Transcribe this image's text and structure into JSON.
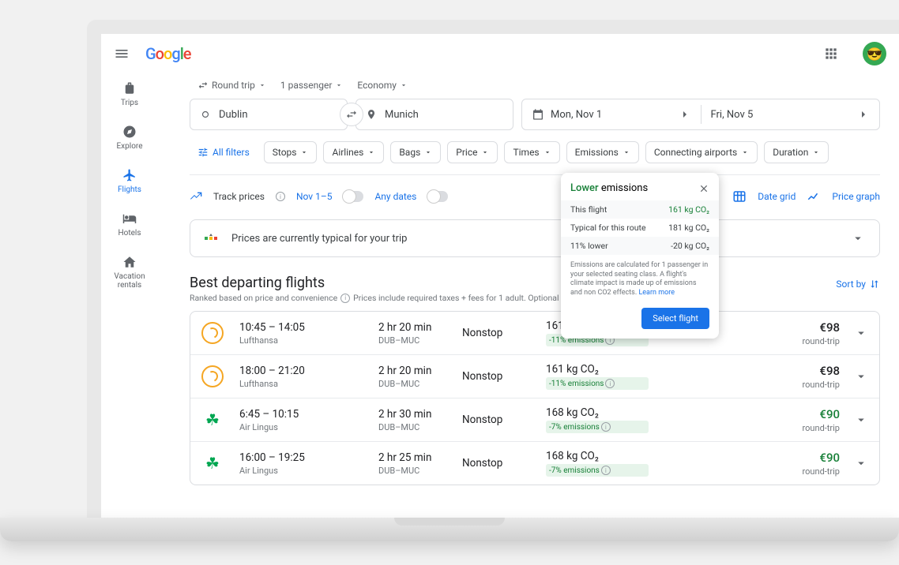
{
  "header": {
    "logo_chars": [
      "G",
      "o",
      "o",
      "g",
      "l",
      "e"
    ]
  },
  "sidebar": {
    "items": [
      {
        "label": "Trips"
      },
      {
        "label": "Explore"
      },
      {
        "label": "Flights"
      },
      {
        "label": "Hotels"
      },
      {
        "label": "Vacation rentals"
      }
    ]
  },
  "trip": {
    "type": "Round trip",
    "passengers": "1 passenger",
    "class": "Economy"
  },
  "search": {
    "origin": "Dublin",
    "destination": "Munich",
    "depart": "Mon, Nov 1",
    "return": "Fri, Nov 5"
  },
  "filters": {
    "all": "All filters",
    "chips": [
      "Stops",
      "Airlines",
      "Bags",
      "Price",
      "Times",
      "Emissions",
      "Connecting airports",
      "Duration"
    ]
  },
  "track": {
    "label": "Track prices",
    "range": "Nov 1–5",
    "any": "Any dates",
    "date_grid": "Date grid",
    "price_graph": "Price graph"
  },
  "banner": {
    "text": "Prices are currently typical for your trip"
  },
  "section": {
    "title": "Best departing flights",
    "sub1": "Ranked based on price and convenience",
    "sub2": "Prices include required taxes + fees for 1 adult. Optional charg",
    "sort": "Sort by"
  },
  "flights": [
    {
      "times": "10:45 – 14:05",
      "airline": "Lufthansa",
      "duration": "2 hr 20 min",
      "route": "DUB–MUC",
      "stops": "Nonstop",
      "co2": "161 kg CO₂",
      "emiss": "-11% emissions",
      "price": "€98",
      "pricenote": "round-trip",
      "logo": "lufthansa",
      "green": false
    },
    {
      "times": "18:00 – 21:20",
      "airline": "Lufthansa",
      "duration": "2 hr 20 min",
      "route": "DUB–MUC",
      "stops": "Nonstop",
      "co2": "161 kg CO₂",
      "emiss": "-11% emissions",
      "price": "€98",
      "pricenote": "round-trip",
      "logo": "lufthansa",
      "green": false
    },
    {
      "times": "6:45 – 10:15",
      "airline": "Air Lingus",
      "duration": "2 hr 30 min",
      "route": "DUB–MUC",
      "stops": "Nonstop",
      "co2": "168 kg CO₂",
      "emiss": "-7% emissions",
      "price": "€90",
      "pricenote": "round-trip",
      "logo": "aerlingus",
      "green": true
    },
    {
      "times": "16:00 – 19:25",
      "airline": "Air Lingus",
      "duration": "2 hr 25 min",
      "route": "DUB–MUC",
      "stops": "Nonstop",
      "co2": "168 kg CO₂",
      "emiss": "-7% emissions",
      "price": "€90",
      "pricenote": "round-trip",
      "logo": "aerlingus",
      "green": true
    }
  ],
  "popover": {
    "lower": "Lower",
    "emissions": " emissions",
    "rows": [
      {
        "k": "This flight",
        "v": "161 kg CO₂",
        "hl": true,
        "green": true
      },
      {
        "k": "Typical for this route",
        "v": "181 kg CO₂",
        "hl": false,
        "green": false
      },
      {
        "k": "11% lower",
        "v": "-20 kg CO₂",
        "hl": true,
        "green": false
      }
    ],
    "note": "Emissions are calculated for 1 passenger in your selected seating class. A flight's climate impact is made up of emissions and non CO2 effects. ",
    "learn": "Learn more",
    "button": "Select flight"
  }
}
